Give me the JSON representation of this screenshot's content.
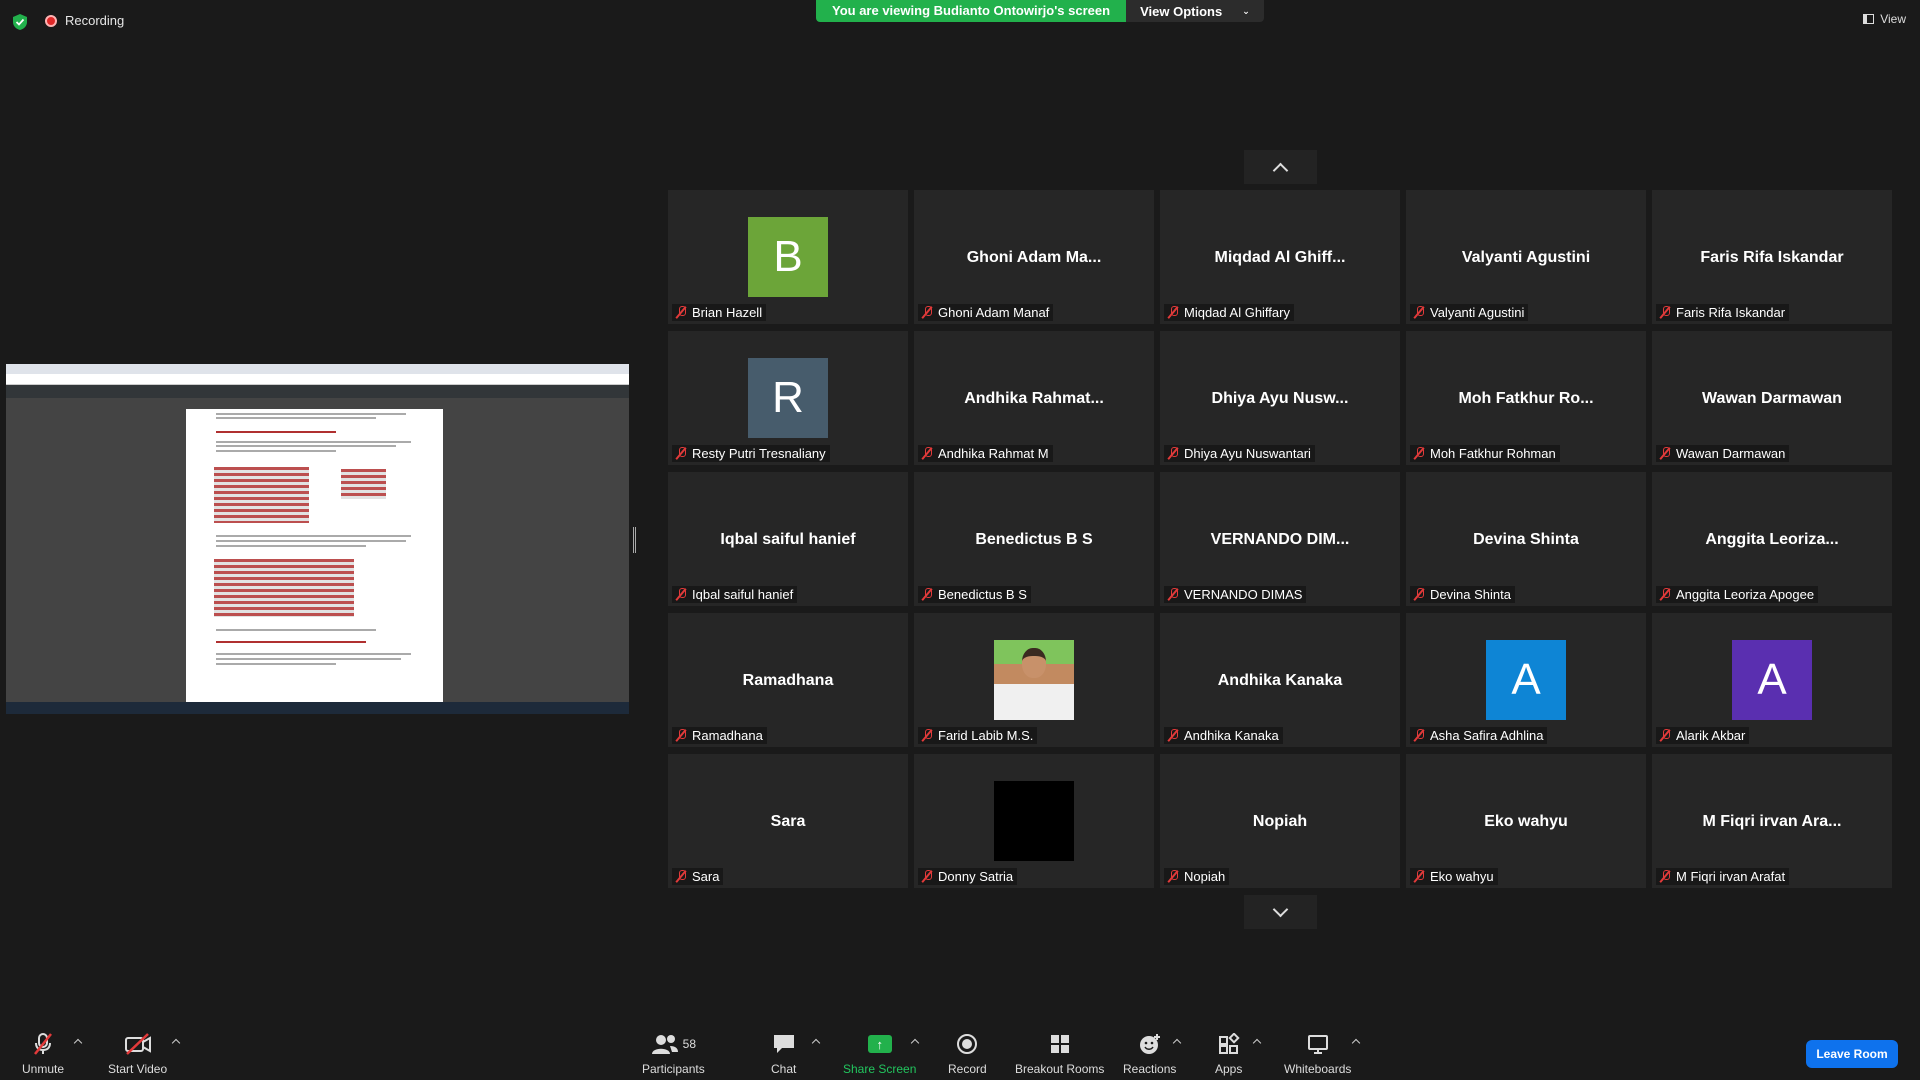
{
  "topbar": {
    "recording_label": "Recording",
    "banner_text": "You are viewing Budianto Ontowirjo's screen",
    "view_options_label": "View Options",
    "view_label": "View"
  },
  "tiles": [
    {
      "big": "",
      "avatar_letter": "B",
      "avatar_color": "#6ca539",
      "name": "Brian Hazell"
    },
    {
      "big": "Ghoni Adam Ma...",
      "name": "Ghoni Adam Manaf"
    },
    {
      "big": "Miqdad Al Ghiff...",
      "name": "Miqdad Al Ghiffary"
    },
    {
      "big": "Valyanti Agustini",
      "name": "Valyanti Agustini"
    },
    {
      "big": "Faris Rifa Iskandar",
      "name": "Faris Rifa Iskandar"
    },
    {
      "big": "",
      "avatar_letter": "R",
      "avatar_color": "#475c6c",
      "name": "Resty Putri Tresnaliany"
    },
    {
      "big": "Andhika Rahmat...",
      "name": "Andhika Rahmat M"
    },
    {
      "big": "Dhiya Ayu Nusw...",
      "name": "Dhiya Ayu Nuswantari"
    },
    {
      "big": "Moh Fatkhur Ro...",
      "name": "Moh Fatkhur Rohman"
    },
    {
      "big": "Wawan Darmawan",
      "name": "Wawan Darmawan"
    },
    {
      "big": "Iqbal saiful hanief",
      "name": "Iqbal saiful hanief"
    },
    {
      "big": "Benedictus B S",
      "name": "Benedictus B S"
    },
    {
      "big": "VERNANDO DIM...",
      "name": "VERNANDO DIMAS"
    },
    {
      "big": "Devina Shinta",
      "name": "Devina Shinta"
    },
    {
      "big": "Anggita Leoriza...",
      "name": "Anggita Leoriza Apogee"
    },
    {
      "big": "Ramadhana",
      "name": "Ramadhana"
    },
    {
      "big": "",
      "photo": true,
      "name": "Farid Labib M.S."
    },
    {
      "big": "Andhika Kanaka",
      "name": "Andhika Kanaka"
    },
    {
      "big": "",
      "avatar_letter": "A",
      "avatar_color": "#0e85d5",
      "name": "Asha Safira Adhlina"
    },
    {
      "big": "",
      "avatar_letter": "A",
      "avatar_color": "#5a2fb0",
      "name": "Alarik Akbar"
    },
    {
      "big": "Sara",
      "name": "Sara"
    },
    {
      "big": "",
      "black": true,
      "name": "Donny Satria"
    },
    {
      "big": "Nopiah",
      "name": "Nopiah"
    },
    {
      "big": "Eko wahyu",
      "name": "Eko wahyu"
    },
    {
      "big": "M Fiqri irvan Ara...",
      "name": "M Fiqri irvan Arafat"
    }
  ],
  "toolbar": {
    "unmute": "Unmute",
    "start_video": "Start Video",
    "participants": "Participants",
    "participants_count": "58",
    "chat": "Chat",
    "share_screen": "Share Screen",
    "record": "Record",
    "breakout_rooms": "Breakout Rooms",
    "reactions": "Reactions",
    "apps": "Apps",
    "whiteboards": "Whiteboards",
    "leave_room": "Leave Room"
  }
}
